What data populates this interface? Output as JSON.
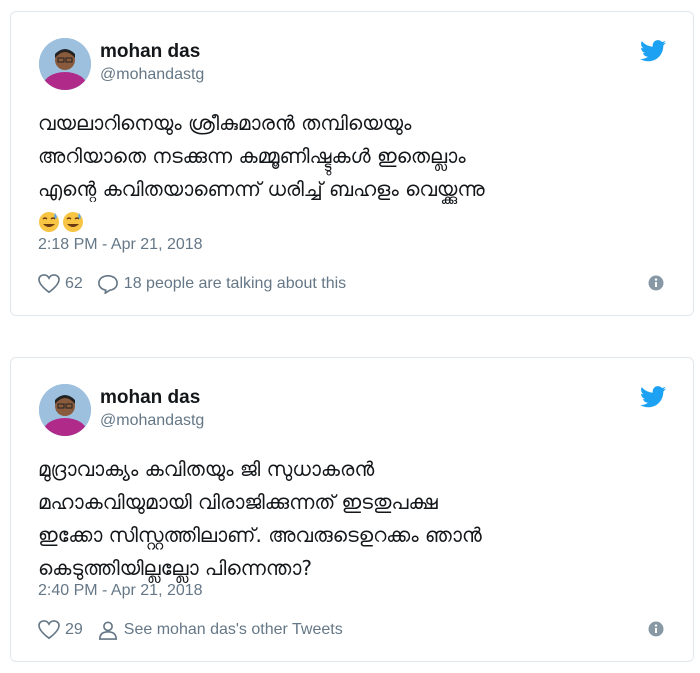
{
  "colors": {
    "brand": "#1da1f2",
    "text": "#14171a",
    "muted": "#657786",
    "border": "#e1e8ed"
  },
  "tweets": [
    {
      "name": "mohan das",
      "handle": "@mohandastg",
      "text": "വയലാറിനെയും ശ്രീകുമാരൻ തമ്പിയെയും\nഅറിയാതെ നടക്കുന്ന കമ്മൂണിഷ്ടുകൾ ഇതെല്ലാം\nഎന്റെ കവിതയാണെന്ന് ധരിച്ച് ബഹളം വെയ്ക്കുന്നു",
      "emoji": [
        "sweat-smile-emoji",
        "sweat-smile-emoji"
      ],
      "time": "2:18 PM - Apr 21, 2018",
      "likes": "62",
      "secondary_action": "18 people are talking about this",
      "secondary_icon": "speech-bubble-icon"
    },
    {
      "name": "mohan das",
      "handle": "@mohandastg",
      "text": "മുദ്രാവാക്യം കവിതയും ജി സുധാകരൻ\nമഹാകവിയുമായി വിരാജിക്കുന്നത് ഇടതുപക്ഷ\nഇക്കോ സിസ്റ്റത്തിലാണ്. അവരുടെഉറക്കം ഞാൻ\nകെടുത്തിയില്ലല്ലോ പിന്നെന്താ?",
      "time": "2:40 PM - Apr 21, 2018",
      "likes": "29",
      "secondary_action": "See mohan das's other Tweets",
      "secondary_icon": "person-icon"
    }
  ]
}
